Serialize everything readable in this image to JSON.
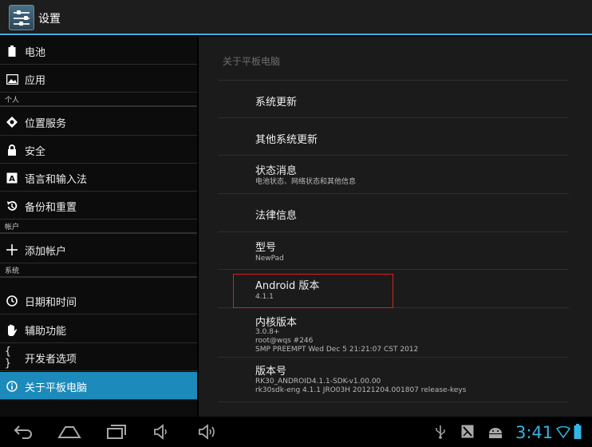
{
  "action_bar": {
    "title": "设置",
    "icon": "settings-sliders-icon"
  },
  "sidebar": {
    "rows": [
      {
        "type": "item",
        "label": "电池",
        "icon": "battery-icon"
      },
      {
        "type": "item",
        "label": "应用",
        "icon": "apps-icon"
      },
      {
        "type": "header",
        "label": "个人"
      },
      {
        "type": "item",
        "label": "位置服务",
        "icon": "location-icon"
      },
      {
        "type": "item",
        "label": "安全",
        "icon": "lock-icon"
      },
      {
        "type": "item",
        "label": "语言和输入法",
        "icon": "keyboard-icon"
      },
      {
        "type": "item",
        "label": "备份和重置",
        "icon": "backup-icon"
      },
      {
        "type": "header",
        "label": "帐户"
      },
      {
        "type": "item",
        "label": "添加帐户",
        "icon": "add-icon"
      },
      {
        "type": "header",
        "label": "系统"
      },
      {
        "type": "item",
        "label": "日期和时间",
        "icon": "clock-icon"
      },
      {
        "type": "item",
        "label": "辅助功能",
        "icon": "hand-icon"
      },
      {
        "type": "item",
        "label": "开发者选项",
        "icon": "braces-icon"
      },
      {
        "type": "item",
        "label": "关于平板电脑",
        "icon": "info-icon",
        "selected": true
      }
    ]
  },
  "detail": {
    "title": "关于平板电脑",
    "items": [
      {
        "title": "系统更新",
        "summary": []
      },
      {
        "title": "其他系统更新",
        "summary": []
      },
      {
        "title": "状态消息",
        "summary": [
          "电池状态、网络状态和其他信息"
        ]
      },
      {
        "title": "法律信息",
        "summary": []
      },
      {
        "title": "型号",
        "summary": [
          "NewPad"
        ]
      },
      {
        "title": "Android 版本",
        "summary": [
          "4.1.1"
        ],
        "highlighted": true
      },
      {
        "title": "内核版本",
        "summary": [
          "3.0.8+",
          "root@wqs #246",
          "SMP PREEMPT Wed Dec 5 21:21:07 CST 2012"
        ]
      },
      {
        "title": "版本号",
        "summary": [
          "RK30_ANDROID4.1.1-SDK-v1.00.00",
          "rk30sdk-eng 4.1.1 JRO03H 20121204.001807 release-keys"
        ]
      }
    ]
  },
  "nav_bar": {
    "buttons": [
      "back-icon",
      "home-icon",
      "recent-apps-icon",
      "volume-down-icon",
      "volume-up-icon"
    ],
    "status_icons": [
      "usb-icon",
      "screenshot-icon",
      "android-debug-icon"
    ],
    "time": "3:41",
    "indicators": [
      "wifi-icon",
      "battery-status-icon"
    ],
    "accent_color": "#33b5e5"
  }
}
